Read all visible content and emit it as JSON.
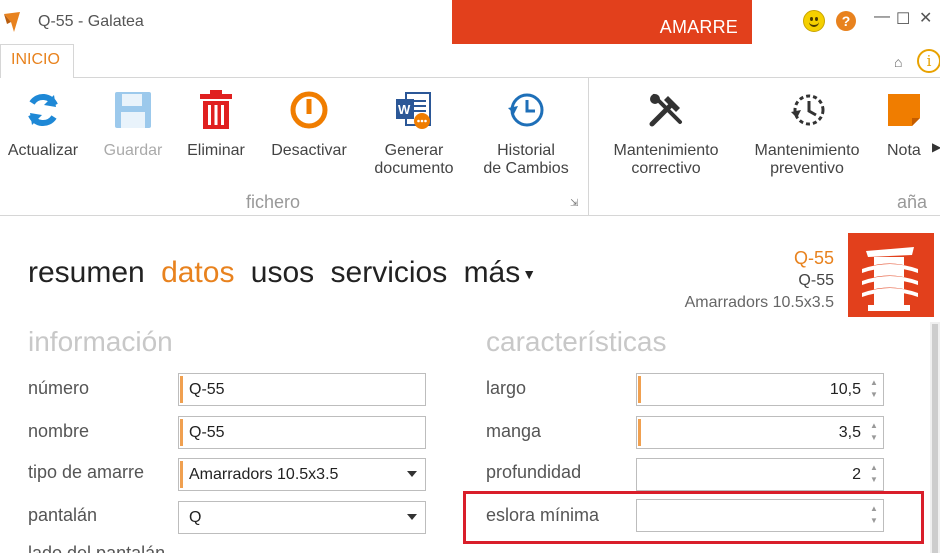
{
  "window": {
    "title": "Q-55 - Galatea",
    "context_tab": "AMARRE"
  },
  "ribbon": {
    "tab": "INICIO",
    "groups": [
      "fichero",
      "aña"
    ],
    "buttons": {
      "actualizar": "Actualizar",
      "guardar": "Guardar",
      "eliminar": "Eliminar",
      "desactivar": "Desactivar",
      "generar_1": "Generar",
      "generar_2": "documento",
      "historial_1": "Historial",
      "historial_2": "de Cambios",
      "mant_corr_1": "Mantenimiento",
      "mant_corr_2": "correctivo",
      "mant_prev_1": "Mantenimiento",
      "mant_prev_2": "preventivo",
      "nota": "Nota"
    }
  },
  "nav": {
    "items": [
      "resumen",
      "datos",
      "usos",
      "servicios",
      "más"
    ],
    "active": "datos"
  },
  "summary": {
    "code": "Q-55",
    "name": "Q-55",
    "type": "Amarradors 10.5x3.5"
  },
  "informacion": {
    "title": "información",
    "numero_label": "número",
    "numero_value": "Q-55",
    "nombre_label": "nombre",
    "nombre_value": "Q-55",
    "tipo_label": "tipo de amarre",
    "tipo_value": "Amarradors 10.5x3.5",
    "pantalan_label": "pantalán",
    "pantalan_value": "Q",
    "cut_label": "lado del pantalán"
  },
  "caracteristicas": {
    "title": "características",
    "largo_label": "largo",
    "largo_value": "10,5",
    "manga_label": "manga",
    "manga_value": "3,5",
    "profundidad_label": "profundidad",
    "profundidad_value": "2",
    "eslora_label": "eslora mínima",
    "eslora_value": ""
  },
  "colors": {
    "accent": "#e8821e",
    "context": "#e2401c",
    "highlight": "#d91e2a"
  }
}
